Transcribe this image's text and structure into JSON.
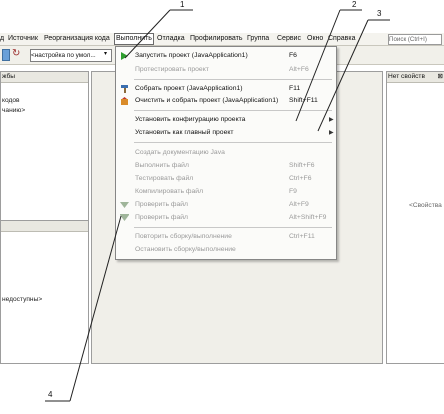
{
  "menubar": {
    "items": [
      "д",
      "Источник",
      "Реорганизация кода",
      "Выполнить",
      "Отладка",
      "Профилировать",
      "Группа",
      "Сервис",
      "Окно",
      "Справка"
    ],
    "search_placeholder": "Поиск (Ctrl+I)"
  },
  "toolbar": {
    "config_value": "<настройка по умол..."
  },
  "left_panel": {
    "header": "жбы",
    "lines": [
      "кодов",
      "чанию>"
    ]
  },
  "left_bottom_panel": {
    "text": "недоступны>"
  },
  "right_panel": {
    "header": "Нет свойств",
    "text": "<Свойства"
  },
  "run_menu": {
    "items": [
      {
        "label": "Запустить проект (JavaApplication1)",
        "shortcut": "F6",
        "enabled": true,
        "icon": "play-icon"
      },
      {
        "label": "Протестировать проект",
        "shortcut": "Alt+F6",
        "enabled": false
      },
      {
        "label": "Собрать проект (JavaApplication1)",
        "shortcut": "F11",
        "enabled": true,
        "icon": "hammer-icon"
      },
      {
        "label": "Очистить и собрать проект (JavaApplication1)",
        "shortcut": "Shift+F11",
        "enabled": true,
        "icon": "clean-build-icon"
      },
      {
        "label": "Установить конфигурацию проекта",
        "shortcut": "",
        "enabled": true,
        "submenu": true
      },
      {
        "label": "Установить как главный проект",
        "shortcut": "",
        "enabled": true,
        "submenu": true
      },
      {
        "label": "Создать документацию Java",
        "shortcut": "",
        "enabled": false
      },
      {
        "label": "Выполнить файл",
        "shortcut": "Shift+F6",
        "enabled": false
      },
      {
        "label": "Тестировать файл",
        "shortcut": "Ctrl+F6",
        "enabled": false
      },
      {
        "label": "Компилировать файл",
        "shortcut": "F9",
        "enabled": false
      },
      {
        "label": "Проверить файл",
        "shortcut": "Alt+F9",
        "enabled": false,
        "icon": "check-file-icon"
      },
      {
        "label": "Проверить файл",
        "shortcut": "Alt+Shift+F9",
        "enabled": false,
        "icon": "validate-file-icon"
      },
      {
        "label": "Повторить сборку/выполнение",
        "shortcut": "Ctrl+F11",
        "enabled": false
      },
      {
        "label": "Остановить сборку/выполнение",
        "shortcut": "",
        "enabled": false
      }
    ]
  },
  "callouts": [
    "1",
    "2",
    "3",
    "4"
  ],
  "colors": {
    "menu_bg": "#fbfbf9",
    "chrome": "#f4f3ee",
    "disabled_text": "#9a9a9a",
    "play_green": "#2e9e2e"
  }
}
